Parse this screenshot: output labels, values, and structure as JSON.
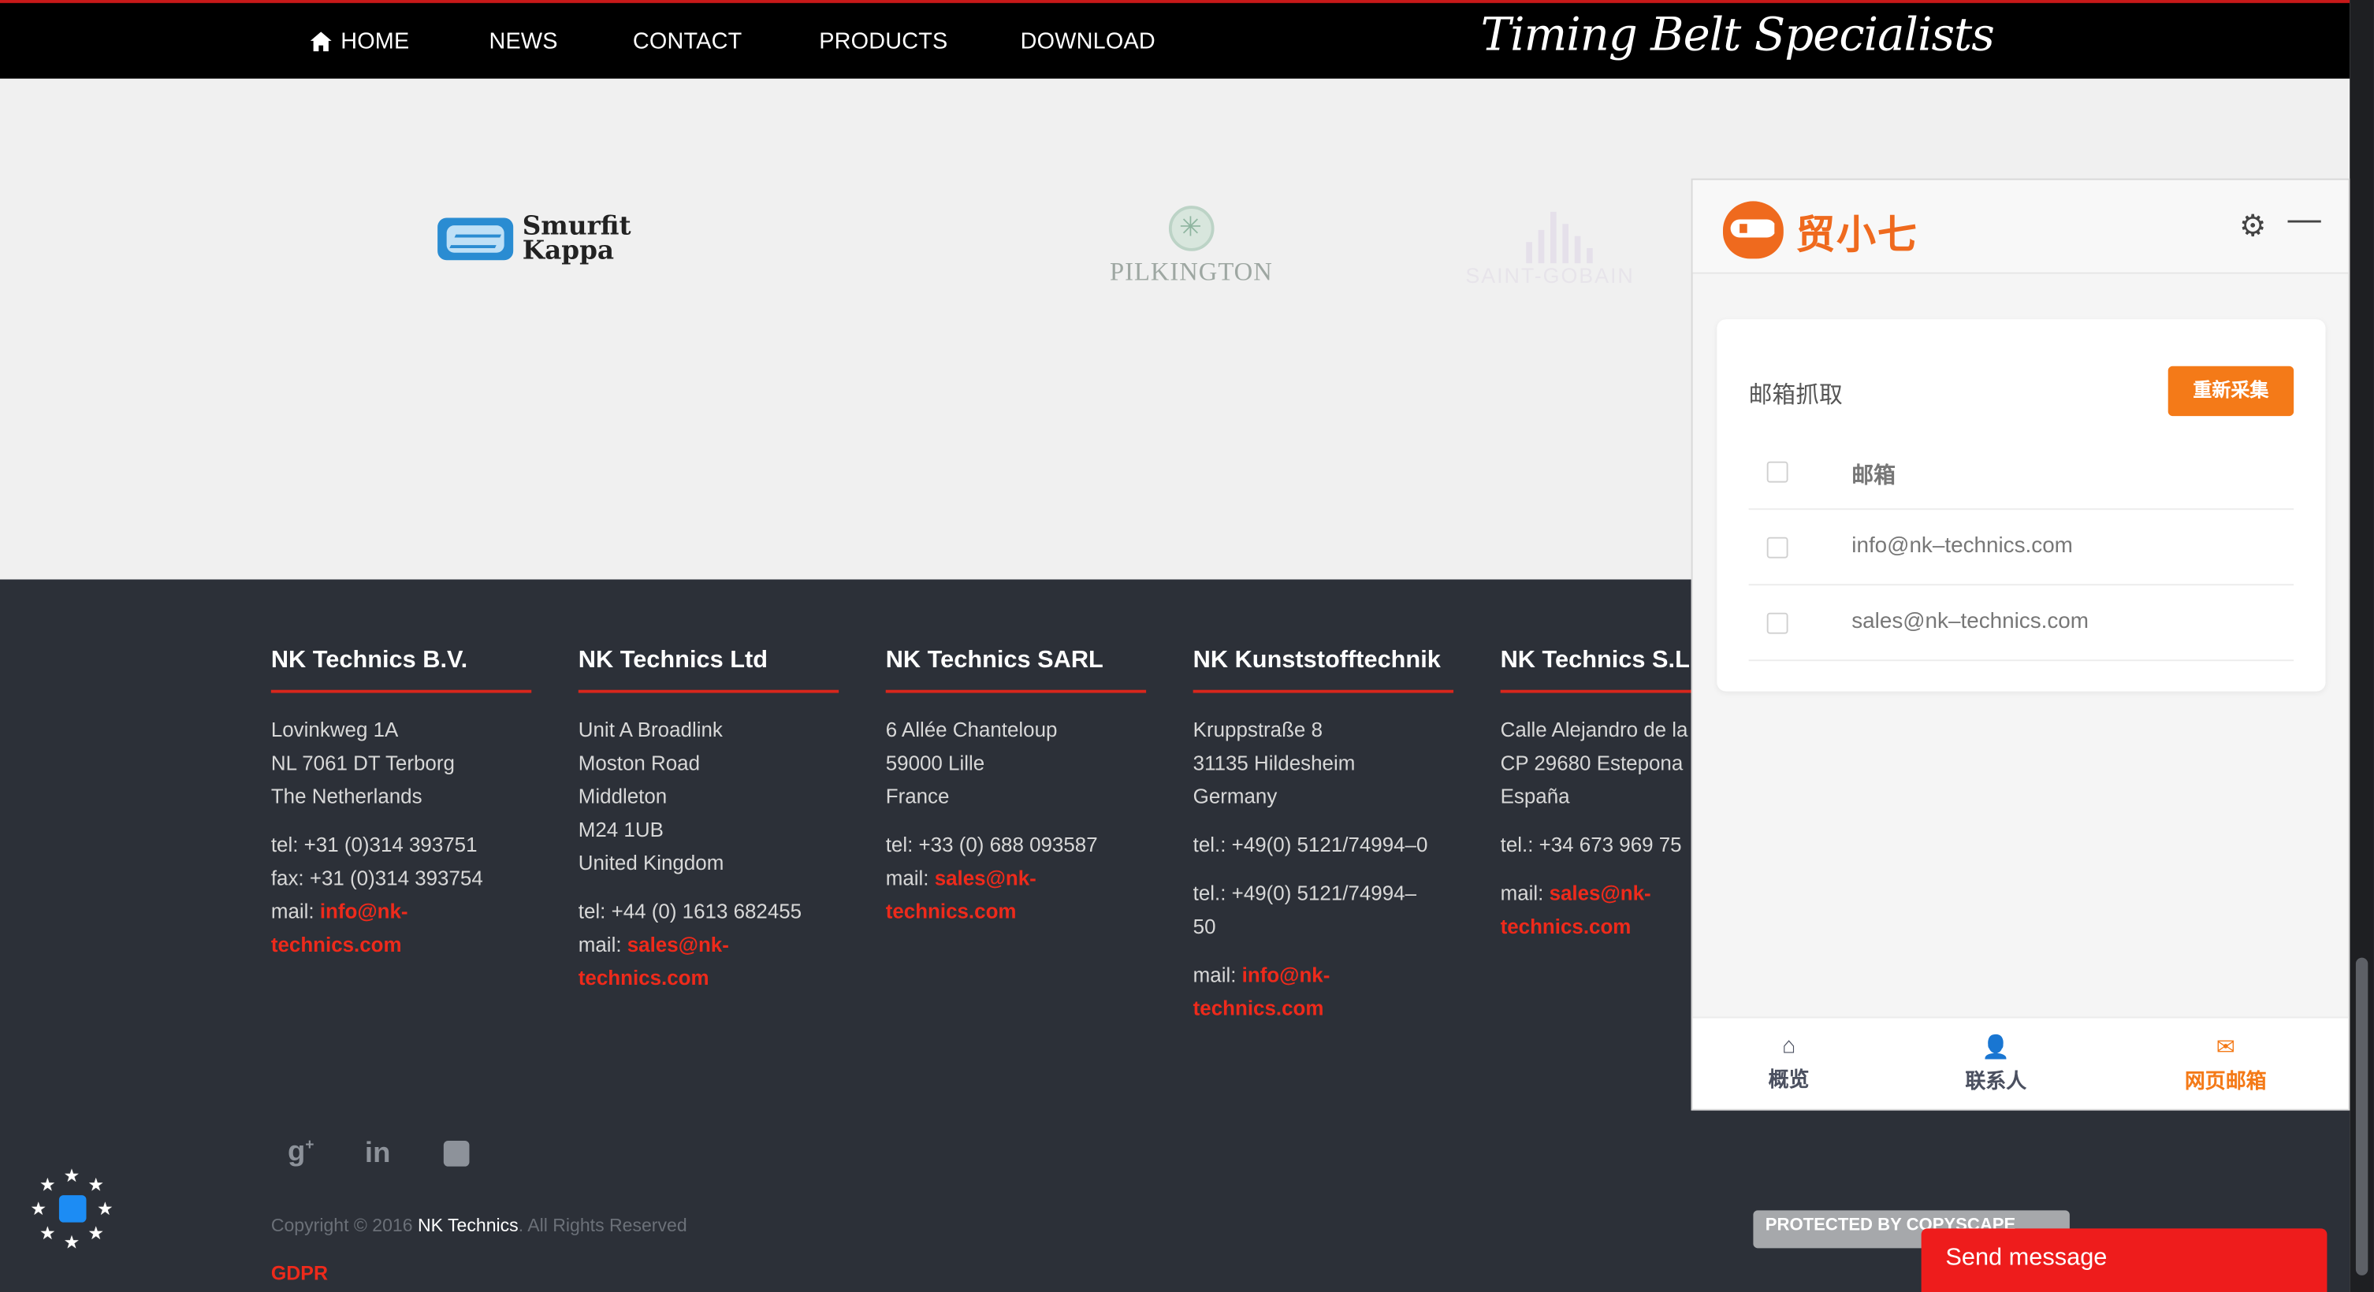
{
  "nav": {
    "items": [
      "HOME",
      "NEWS",
      "CONTACT",
      "PRODUCTS",
      "DOWNLOAD"
    ],
    "brand": "Timing Belt Specialists"
  },
  "clients": {
    "smurfit_line1": "Smurfit",
    "smurfit_line2": "Kappa",
    "pilkington": "PILKINGTON",
    "saint_gobain": "SAINT-GOBAIN"
  },
  "footer": {
    "columns": [
      {
        "title": "NK Technics B.V.",
        "address": [
          "Lovinkweg 1A",
          "NL 7061 DT Terborg",
          "The Netherlands"
        ],
        "contact": [
          "tel: +31 (0)314 393751",
          "fax: +31 (0)314 393754"
        ],
        "mail_label": "mail: ",
        "mail_1": "info@nk-",
        "mail_2": "technics.com"
      },
      {
        "title": "NK Technics Ltd",
        "address": [
          "Unit A Broadlink",
          "Moston Road",
          "Middleton",
          "M24 1UB",
          "United Kingdom"
        ],
        "contact": [
          "tel: +44 (0) 1613 682455"
        ],
        "mail_label": "mail: ",
        "mail_1": "sales@nk-",
        "mail_2": "technics.com"
      },
      {
        "title": "NK Technics SARL",
        "address": [
          "6 Allée Chanteloup",
          "59000 Lille",
          "France"
        ],
        "contact": [
          "tel: +33 (0) 688 093587"
        ],
        "mail_label": "mail: ",
        "mail_1": "sales@nk-",
        "mail_2": "technics.com"
      },
      {
        "title": "NK Kunststofftechnik",
        "address": [
          "Kruppstraße 8",
          "31135 Hildesheim",
          "Germany"
        ],
        "contact": [
          "tel.: +49(0) 5121/74994–0",
          "tel.: +49(0) 5121/74994–",
          "50"
        ],
        "mail_label": "mail: ",
        "mail_1": "info@nk-",
        "mail_2": "technics.com"
      },
      {
        "title": "NK Technics S.L.",
        "address": [
          "Calle Alejandro de la",
          "CP 29680 Estepona",
          "España"
        ],
        "contact": [
          "tel.: +34 673 969 75"
        ],
        "mail_label": "mail: ",
        "mail_1": "sales@nk-",
        "mail_2": "technics.com"
      }
    ],
    "social_icons": [
      "google-plus-icon",
      "linkedin-icon",
      "youtube-icon"
    ],
    "copyright_pre": "Copyright © 2016 ",
    "copyright_brand": "NK Technics",
    "copyright_post": ". All Rights Reserved",
    "gdpr": "GDPR"
  },
  "badges": {
    "copyscape": "PROTECTED BY COPYSCAPE",
    "send_message": "Send message"
  },
  "panel": {
    "title": "贸小七",
    "card_title": "邮箱抓取",
    "recollect": "重新采集",
    "column_header": "邮箱",
    "emails": [
      "info@nk–technics.com",
      "sales@nk–technics.com"
    ],
    "tabs": [
      "概览",
      "联系人",
      "网页邮箱"
    ],
    "accent": "#f47a18"
  }
}
